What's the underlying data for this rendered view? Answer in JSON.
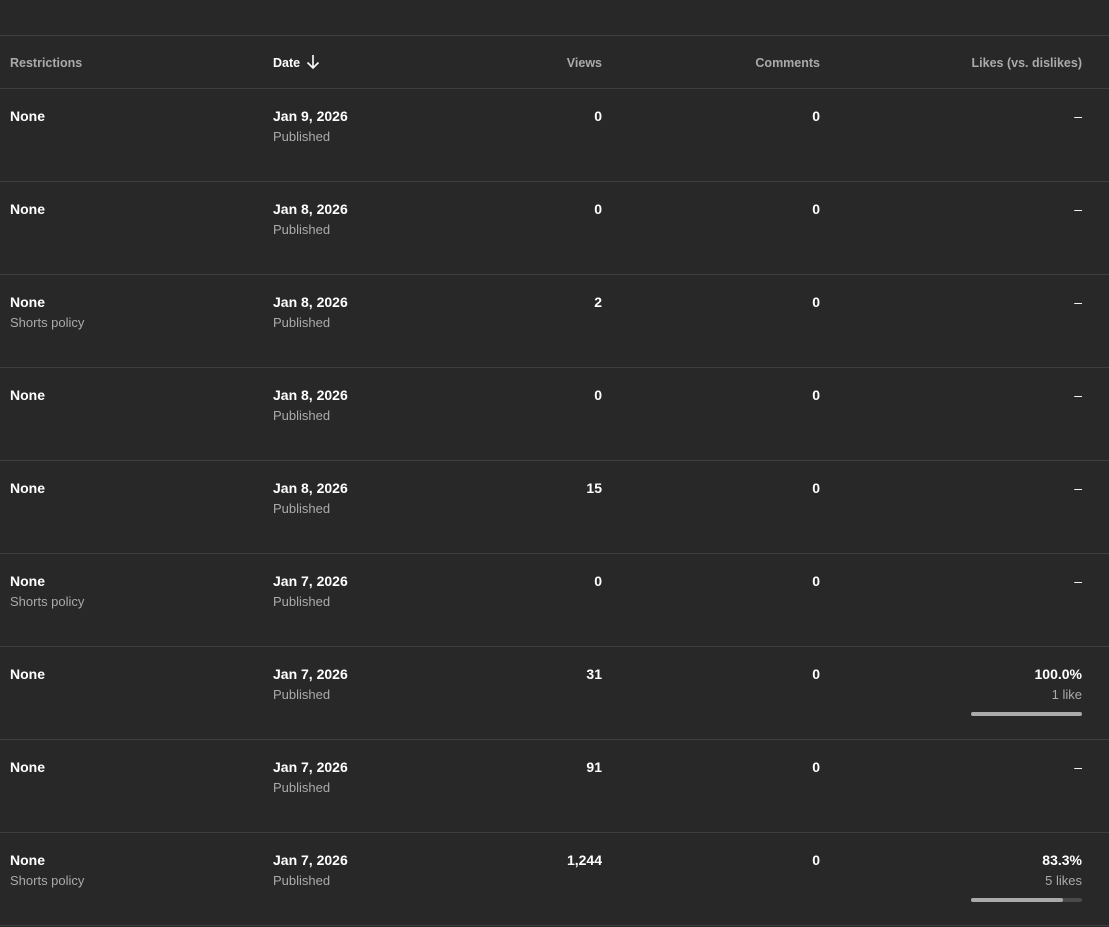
{
  "table": {
    "headers": {
      "restrictions": "Restrictions",
      "date": "Date",
      "views": "Views",
      "comments": "Comments",
      "likes": "Likes (vs. dislikes)"
    },
    "sort_icon": "arrow-down-icon",
    "rows": [
      {
        "restriction": "None",
        "restriction_note": "",
        "date": "Jan 9, 2026",
        "status": "Published",
        "views": "0",
        "comments": "0",
        "likes": "–",
        "likes_note": "",
        "likes_ratio": null
      },
      {
        "restriction": "None",
        "restriction_note": "",
        "date": "Jan 8, 2026",
        "status": "Published",
        "views": "0",
        "comments": "0",
        "likes": "–",
        "likes_note": "",
        "likes_ratio": null
      },
      {
        "restriction": "None",
        "restriction_note": "Shorts policy",
        "date": "Jan 8, 2026",
        "status": "Published",
        "views": "2",
        "comments": "0",
        "likes": "–",
        "likes_note": "",
        "likes_ratio": null
      },
      {
        "restriction": "None",
        "restriction_note": "",
        "date": "Jan 8, 2026",
        "status": "Published",
        "views": "0",
        "comments": "0",
        "likes": "–",
        "likes_note": "",
        "likes_ratio": null
      },
      {
        "restriction": "None",
        "restriction_note": "",
        "date": "Jan 8, 2026",
        "status": "Published",
        "views": "15",
        "comments": "0",
        "likes": "–",
        "likes_note": "",
        "likes_ratio": null
      },
      {
        "restriction": "None",
        "restriction_note": "Shorts policy",
        "date": "Jan 7, 2026",
        "status": "Published",
        "views": "0",
        "comments": "0",
        "likes": "–",
        "likes_note": "",
        "likes_ratio": null
      },
      {
        "restriction": "None",
        "restriction_note": "",
        "date": "Jan 7, 2026",
        "status": "Published",
        "views": "31",
        "comments": "0",
        "likes": "100.0%",
        "likes_note": "1 like",
        "likes_ratio": 1.0
      },
      {
        "restriction": "None",
        "restriction_note": "",
        "date": "Jan 7, 2026",
        "status": "Published",
        "views": "91",
        "comments": "0",
        "likes": "–",
        "likes_note": "",
        "likes_ratio": null
      },
      {
        "restriction": "None",
        "restriction_note": "Shorts policy",
        "date": "Jan 7, 2026",
        "status": "Published",
        "views": "1,244",
        "comments": "0",
        "likes": "83.3%",
        "likes_note": "5 likes",
        "likes_ratio": 0.833
      }
    ]
  },
  "colors": {
    "background": "#282828",
    "divider": "#3e3e3e",
    "text_primary": "#ffffff",
    "text_secondary": "#aaaaaa",
    "bar_track": "#4a4a4a",
    "bar_fill": "#aaaaaa"
  }
}
